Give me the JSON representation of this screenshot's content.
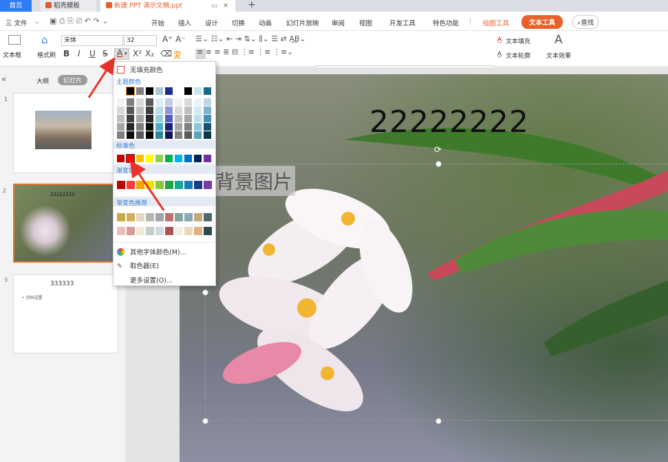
{
  "tabs": {
    "home": "首页",
    "template": "稻壳模板",
    "doc": "新建 PPT 演示文稿.ppt",
    "add": "+"
  },
  "menu": {
    "file": "三 文件",
    "items": [
      "开始",
      "插入",
      "设计",
      "切换",
      "动画",
      "幻灯片放映",
      "审阅",
      "视图",
      "开发工具",
      "特色功能"
    ],
    "draw_tools": "绘图工具",
    "text_tools": "文本工具",
    "search": "查找"
  },
  "ribbon": {
    "textbox": "文本框",
    "format_painter": "格式刷",
    "font": "宋体",
    "size": "32",
    "text_fill": "文本填充",
    "text_outline": "文本轮廓",
    "text_effect": "文本效果"
  },
  "left": {
    "outline": "大纲",
    "slides": "幻灯片",
    "nums": [
      "1",
      "2",
      "3"
    ],
    "thumb2_title": "22222222",
    "thumb3_title": "333333",
    "thumb3_bullet": "• 页码设置"
  },
  "slide": {
    "title": "22222222",
    "body": "背景图片"
  },
  "color_menu": {
    "no_fill": "无填充颜色",
    "theme": "主题颜色",
    "standard": "标准色",
    "gradient": "渐变填充",
    "gradient_rec": "渐变色推荐",
    "other": "其他字体颜色(M)...",
    "picker": "取色器(E)",
    "more": "更多设置(O)...",
    "theme_top": [
      "#ffffff",
      "#000000",
      "#808080",
      "#000000",
      "#a4cbd4",
      "#1f2c8c",
      "#ffffff",
      "#000000",
      "#c8e4ec",
      "#1c6b8a"
    ],
    "theme_shades": [
      [
        "#f2f2f2",
        "#7f7f7f",
        "#d9d9d9",
        "#595959",
        "#dbeef3",
        "#c5cae9",
        "#f2f2f2",
        "#d9d9d9",
        "#e8f4f8",
        "#bcd7e6"
      ],
      [
        "#d9d9d9",
        "#595959",
        "#bfbfbf",
        "#3f3f3f",
        "#b7dde8",
        "#8c95d3",
        "#d9d9d9",
        "#bfbfbf",
        "#d1e9f1",
        "#7eb3cf"
      ],
      [
        "#bfbfbf",
        "#404040",
        "#a6a6a6",
        "#262626",
        "#92cddc",
        "#525fbd",
        "#bfbfbf",
        "#a6a6a6",
        "#bae0ea",
        "#4a90b8"
      ],
      [
        "#a6a6a6",
        "#262626",
        "#7f7f7f",
        "#0c0c0c",
        "#4bacc6",
        "#17207a",
        "#a6a6a6",
        "#7f7f7f",
        "#89c7d8",
        "#155170"
      ],
      [
        "#808080",
        "#0d0d0d",
        "#595959",
        "#000000",
        "#31849b",
        "#0f1651",
        "#808080",
        "#595959",
        "#5ba3bb",
        "#0e374b"
      ]
    ],
    "standard_colors": [
      "#c00000",
      "#ff0000",
      "#ffc000",
      "#ffff00",
      "#92d050",
      "#00b050",
      "#00b0f0",
      "#0070c0",
      "#002060",
      "#7030a0"
    ],
    "gradient_colors": [
      "#c00000",
      "#ff3b3b",
      "#f3a800",
      "#f0e000",
      "#8cc63f",
      "#22a645",
      "#14a79a",
      "#1a7ab8",
      "#1a3b8a",
      "#7b3aa8"
    ],
    "rec_row1": [
      "#c9a84a",
      "#d6b05a",
      "#e0d8c0",
      "#b5b8b0",
      "#9fa5a8",
      "#c07070",
      "#7fa7a0",
      "#8aa8b8",
      "#c8a878",
      "#506870"
    ],
    "rec_row2": [
      "#e8c0b8",
      "#d89a9a",
      "#f0e8d8",
      "#c0d0c8",
      "#d0d8e0",
      "#b05050",
      "#f0f0e8",
      "#e8d8c0",
      "#e0b080",
      "#304850"
    ]
  }
}
